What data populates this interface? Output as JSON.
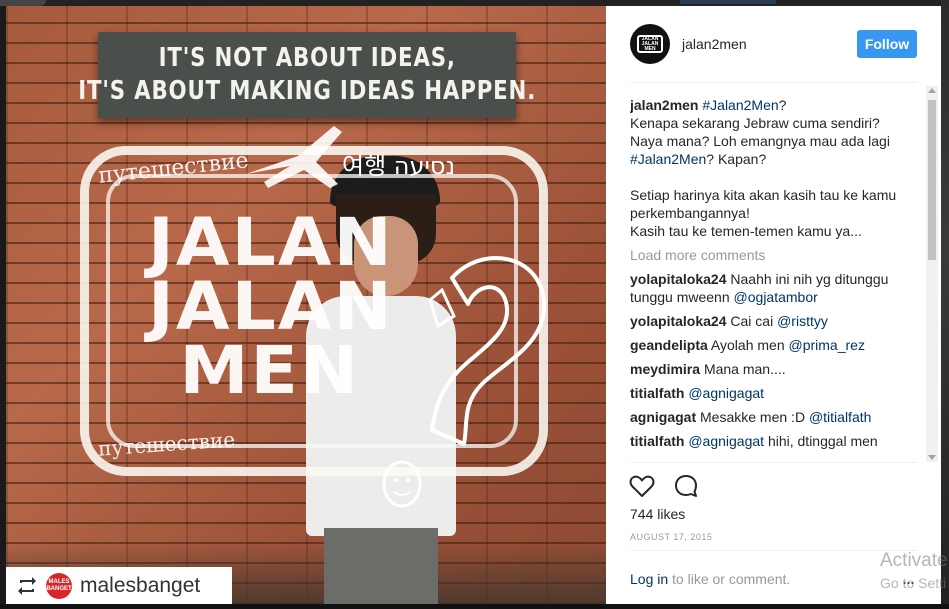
{
  "media": {
    "sign_line1": "IT'S NOT ABOUT IDEAS,",
    "sign_line2": "IT'S ABOUT MAKING IDEAS HAPPEN.",
    "stamp_text_top": "путешествие",
    "stamp_text_korean": "여행 נסיעה",
    "stamp_text_bottom": "путешествие",
    "stamp_title_1": "JALAN",
    "stamp_title_2": "JALAN",
    "stamp_title_3": "MEN",
    "credit": {
      "repost_icon": "repost-icon",
      "logo_text": "MALES BANGET",
      "name": "malesbanget"
    }
  },
  "post": {
    "username": "jalan2men",
    "avatar_text": "JALAN JALAN MEN",
    "follow_label": "Follow",
    "caption": {
      "author": "jalan2men",
      "hashtag1": "#Jalan2Men",
      "line1_tail": "?",
      "line2": "Kenapa sekarang Jebraw cuma sendiri?",
      "line3": "Naya mana? Loh emangnya mau ada lagi",
      "hashtag2": "#Jalan2Men",
      "line4_tail": "? Kapan?",
      "line5": "Setiap harinya kita akan kasih tau ke kamu",
      "line6": "perkembangannya!",
      "line7": "Kasih tau ke temen-temen kamu ya..."
    },
    "load_more": "Load more comments",
    "comments": [
      {
        "user": "yolapitaloka24",
        "text": "Naahh ini nih yg ditunggu tunggu mweenn",
        "mention": "@ogjatambor"
      },
      {
        "user": "yolapitaloka24",
        "text": "Cai cai",
        "mention": "@risttyy"
      },
      {
        "user": "geandelipta",
        "text": "Ayolah men",
        "mention": "@prima_rez"
      },
      {
        "user": "meydimira",
        "text": "Mana man....",
        "mention": ""
      },
      {
        "user": "titialfath",
        "text": "",
        "mention": "@agnigagat"
      },
      {
        "user": "agnigagat",
        "text": "Mesakke men :D",
        "mention": "@titialfath"
      },
      {
        "user": "titialfath",
        "text": "hihi, dtinggal men",
        "mention": "@agnigagat"
      }
    ],
    "like_icon": "heart-icon",
    "comment_icon": "comment-bubble-icon",
    "likes": "744 likes",
    "date": "AUGUST 17, 2015",
    "login_link": "Log in",
    "login_tail": " to like or comment.",
    "more_label": "..."
  },
  "watermark": {
    "line1": "Activate",
    "line2": "Go to Setti"
  }
}
